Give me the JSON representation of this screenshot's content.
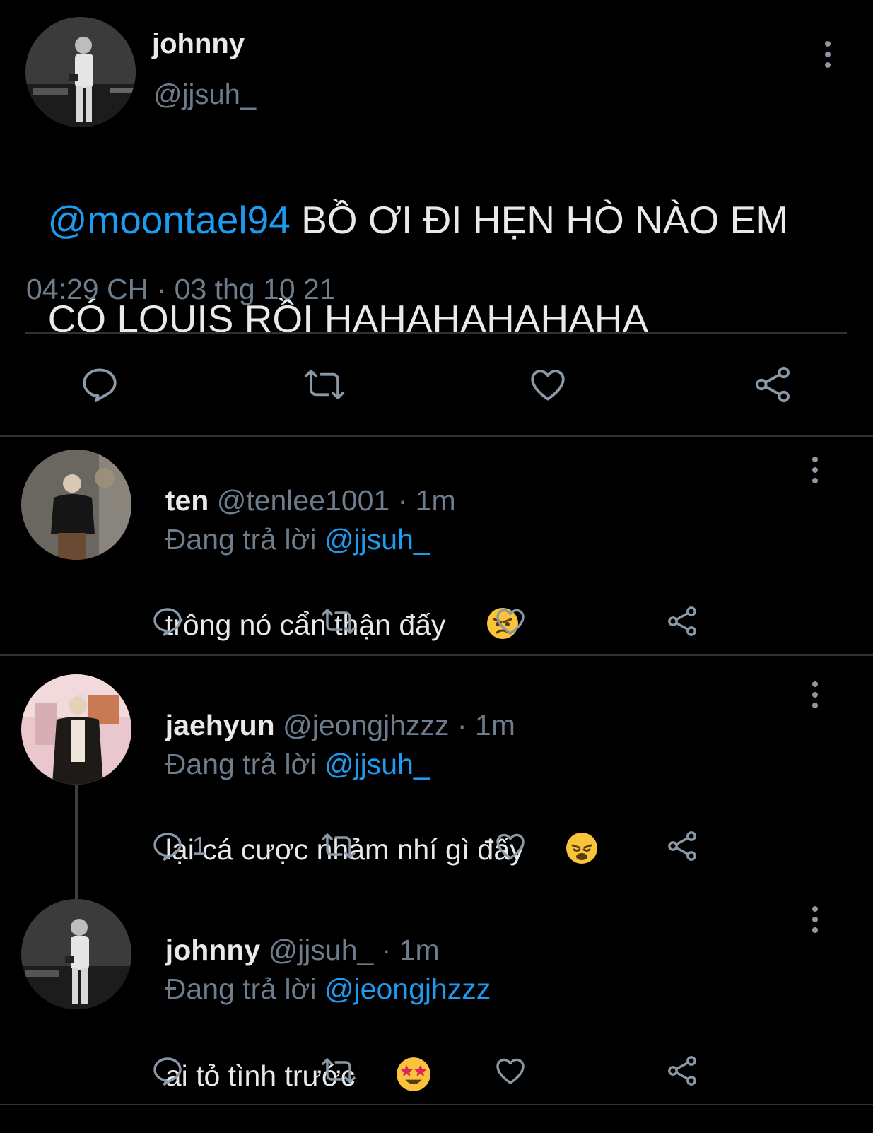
{
  "main_tweet": {
    "display_name": "johnny",
    "handle": "@jjsuh_",
    "mention": "@moontael94",
    "text_line1": " BỒ ƠI ĐI HẸN HÒ NÀO EM",
    "text_line2": "CÓ LOUIS RỒI HAHAHAHAHAHA",
    "timestamp": "04:29 CH · 03 thg 10 21",
    "actions": [
      "reply-icon",
      "retweet-icon",
      "like-icon",
      "share-icon"
    ]
  },
  "replies": [
    {
      "display_name": "ten",
      "handle": "@tenlee1001",
      "time": " · 1m",
      "replying_prefix": "Đang trả lời ",
      "replying_to": "@jjsuh_",
      "text": "trông nó cẩn thận đấy ",
      "emoji": "angry-face-emoji",
      "reply_count": ""
    },
    {
      "display_name": "jaehyun",
      "handle": "@jeongjhzzz",
      "time": " · 1m",
      "replying_prefix": "Đang trả lời ",
      "replying_to": "@jjsuh_",
      "text": "lại cá cược nhảm nhí gì đấy ",
      "emoji": "weary-face-emoji",
      "reply_count": "1"
    },
    {
      "display_name": "johnny",
      "handle": "@jjsuh_",
      "time": " · 1m",
      "replying_prefix": "Đang trả lời ",
      "replying_to": "@jeongjhzzz",
      "text": "ai tỏ tình trước ",
      "emoji": "star-struck-emoji",
      "reply_count": ""
    }
  ],
  "colors": {
    "background": "#000000",
    "text": "#e7e9ea",
    "muted": "#6e7d8c",
    "link": "#1d9bf0",
    "divider": "#2f3336",
    "icon": "#8b98a5"
  }
}
